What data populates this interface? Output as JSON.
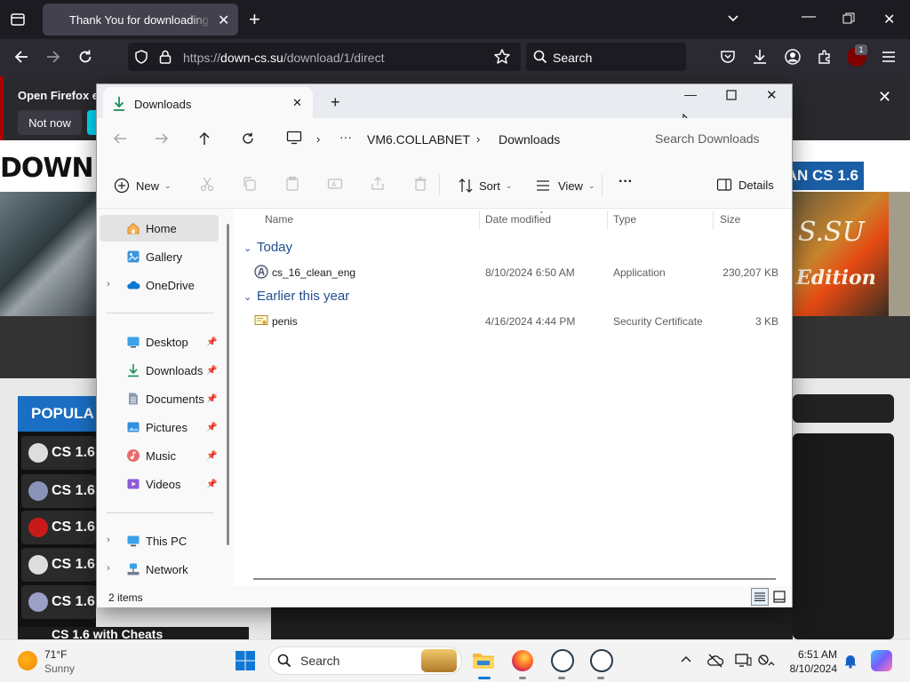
{
  "browser": {
    "tab_title": "Thank You for downloading Cou",
    "url_prefix": "https://",
    "url_host": "down-cs.su",
    "url_path": "/download/1/direct",
    "search_placeholder": "Search",
    "extension_badge": "1"
  },
  "notification": {
    "text": "Open Firefox ev",
    "not_now": "Not now"
  },
  "website": {
    "logo": "DOWN",
    "clean_button": "AN CS 1.6",
    "banner_text_top": "S.SU",
    "banner_text_bottom": "Edition",
    "popular_header": "POPULA",
    "side_items": [
      "CS 1.6",
      "CS 1.6",
      "CS 1.6",
      "CS 1.6",
      "CS 1.6"
    ],
    "bottom_item": "CS 1.6 with Cheats"
  },
  "explorer": {
    "tab_title": "Downloads",
    "breadcrumb": [
      "VM6.COLLABNET",
      "Downloads"
    ],
    "breadcrumb_more": "···",
    "search_placeholder": "Search Downloads",
    "commands": {
      "new": "New",
      "sort": "Sort",
      "view": "View",
      "more": "···",
      "details": "Details"
    },
    "nav": {
      "home": "Home",
      "gallery": "Gallery",
      "onedrive": "OneDrive",
      "desktop": "Desktop",
      "downloads": "Downloads",
      "documents": "Documents",
      "pictures": "Pictures",
      "music": "Music",
      "videos": "Videos",
      "this_pc": "This PC",
      "network": "Network"
    },
    "columns": {
      "name": "Name",
      "date": "Date modified",
      "type": "Type",
      "size": "Size"
    },
    "groups": [
      {
        "label": "Today",
        "files": [
          {
            "name": "cs_16_clean_eng",
            "date": "8/10/2024 6:50 AM",
            "type": "Application",
            "size": "230,207 KB"
          }
        ]
      },
      {
        "label": "Earlier this year",
        "files": [
          {
            "name": "penis",
            "date": "4/16/2024 4:44 PM",
            "type": "Security Certificate",
            "size": "3 KB"
          }
        ]
      }
    ],
    "status": "2 items"
  },
  "taskbar": {
    "temperature": "71°F",
    "weather": "Sunny",
    "search": "Search",
    "time": "6:51 AM",
    "date": "8/10/2024"
  },
  "colors": {
    "accent_blue": "#1f4d90",
    "firefox_dark": "#1c1b22",
    "taskbar": "#f3f3f3"
  }
}
